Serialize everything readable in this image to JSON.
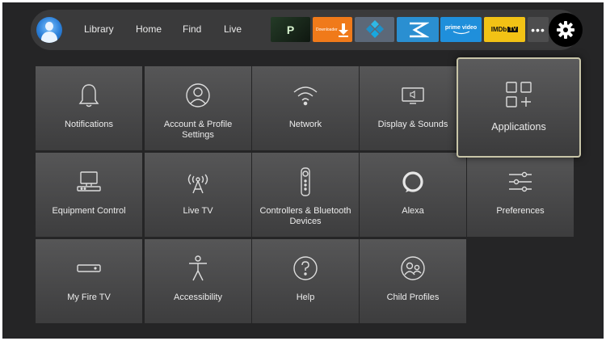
{
  "nav": {
    "items": [
      "Library",
      "Home",
      "Find",
      "Live"
    ]
  },
  "apps": {
    "p_label": "P",
    "downloader_label": "Downloader",
    "prime_line1": "prime video",
    "imdb_label": "IMDb",
    "imdb_tv": "TV",
    "more_label": "•••"
  },
  "tiles": [
    {
      "label": "Notifications",
      "icon": "bell-icon"
    },
    {
      "label": "Account & Profile Settings",
      "icon": "account-icon"
    },
    {
      "label": "Network",
      "icon": "wifi-icon"
    },
    {
      "label": "Display & Sounds",
      "icon": "display-icon"
    },
    {
      "label": "Applications",
      "icon": "apps-grid-icon"
    },
    {
      "label": "Equipment Control",
      "icon": "equipment-icon"
    },
    {
      "label": "Live TV",
      "icon": "antenna-icon"
    },
    {
      "label": "Controllers & Bluetooth Devices",
      "icon": "remote-icon"
    },
    {
      "label": "Alexa",
      "icon": "alexa-icon"
    },
    {
      "label": "Preferences",
      "icon": "sliders-icon"
    },
    {
      "label": "My Fire TV",
      "icon": "firetv-icon"
    },
    {
      "label": "Accessibility",
      "icon": "accessibility-icon"
    },
    {
      "label": "Help",
      "icon": "help-icon"
    },
    {
      "label": "Child Profiles",
      "icon": "child-profiles-icon"
    }
  ],
  "colors": {
    "background": "#252526",
    "tile": "#4a4a4b",
    "focus_border": "#c8c5a8",
    "downloader": "#f07a1a",
    "imdb": "#f2c215",
    "prime": "#1f8fdb"
  }
}
